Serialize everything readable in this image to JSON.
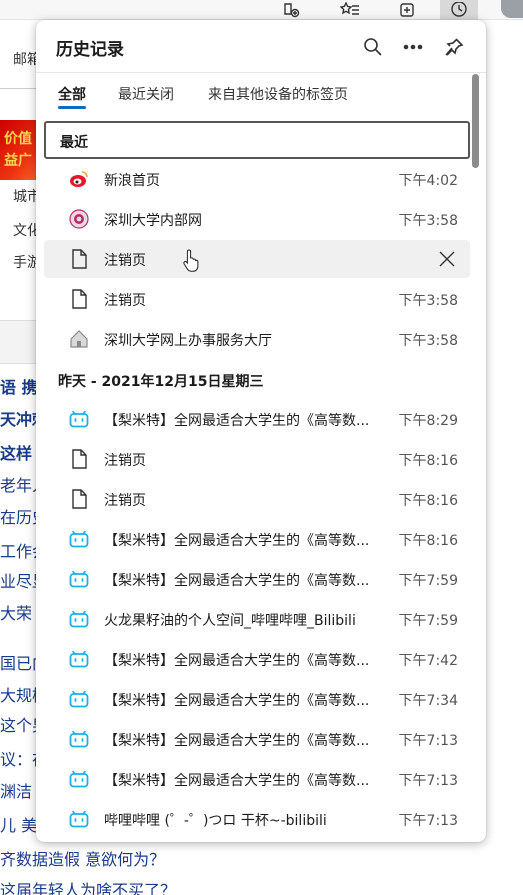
{
  "toolbar": {
    "icons": [
      "add-extension-icon",
      "favorites-icon",
      "collections-icon",
      "history-icon",
      "profile-avatar"
    ]
  },
  "background_page": {
    "top_label": "邮箱",
    "banner_lines": [
      "价值",
      "益广"
    ],
    "side_items": [
      "城市",
      "文化",
      "手游"
    ],
    "lines": [
      "语 携",
      "天冲刺",
      " 这样",
      "老年人",
      "在历史",
      "工作会",
      "业尽显",
      "大荣",
      "国已向",
      "大规模",
      "这个男",
      "议：在",
      "渊洁",
      "儿 美"
    ],
    "bottom_lines": [
      "齐数据造假 意欲何为？",
      "这届年轻人为啥不买了？"
    ]
  },
  "history": {
    "title": "历史记录",
    "header_icons": [
      "search-icon",
      "more-icon",
      "pin-icon"
    ],
    "tabs": [
      "全部",
      "最近关闭",
      "来自其他设备的标签页"
    ],
    "search_label": "最近",
    "recent": [
      {
        "icon": "weibo-icon",
        "title": "新浪首页",
        "time": "下午4:02"
      },
      {
        "icon": "szu-logo-icon",
        "title": "深圳大学内部网",
        "time": "下午3:58"
      },
      {
        "icon": "page-icon",
        "title": "注销页",
        "time": "",
        "hovered": true
      },
      {
        "icon": "page-icon",
        "title": "注销页",
        "time": "下午3:58"
      },
      {
        "icon": "home-icon",
        "title": "深圳大学网上办事服务大厅",
        "time": "下午3:58"
      }
    ],
    "yesterday_heading": "昨天 - 2021年12月15日星期三",
    "yesterday": [
      {
        "icon": "bilibili-icon",
        "title": "【梨米特】全网最适合大学生的《高等数...",
        "time": "下午8:29"
      },
      {
        "icon": "page-icon",
        "title": "注销页",
        "time": "下午8:16"
      },
      {
        "icon": "page-icon",
        "title": "注销页",
        "time": "下午8:16"
      },
      {
        "icon": "bilibili-icon",
        "title": "【梨米特】全网最适合大学生的《高等数...",
        "time": "下午8:16"
      },
      {
        "icon": "bilibili-icon",
        "title": "【梨米特】全网最适合大学生的《高等数...",
        "time": "下午7:59"
      },
      {
        "icon": "bilibili-icon",
        "title": "火龙果籽油的个人空间_哔哩哔哩_Bilibili",
        "time": "下午7:59"
      },
      {
        "icon": "bilibili-icon",
        "title": "【梨米特】全网最适合大学生的《高等数...",
        "time": "下午7:42"
      },
      {
        "icon": "bilibili-icon",
        "title": "【梨米特】全网最适合大学生的《高等数...",
        "time": "下午7:34"
      },
      {
        "icon": "bilibili-icon",
        "title": "【梨米特】全网最适合大学生的《高等数...",
        "time": "下午7:13"
      },
      {
        "icon": "bilibili-icon",
        "title": "【梨米特】全网最适合大学生的《高等数...",
        "time": "下午7:13"
      },
      {
        "icon": "bilibili-icon",
        "title": "哔哩哔哩 (゜-゜)つロ 干杯~-bilibili",
        "time": "下午7:13"
      }
    ]
  },
  "colors": {
    "accent": "#0f6cbd",
    "bilibili": "#23ade5",
    "weibo": "#e6162d",
    "hover_row": "#f0f0f0"
  }
}
